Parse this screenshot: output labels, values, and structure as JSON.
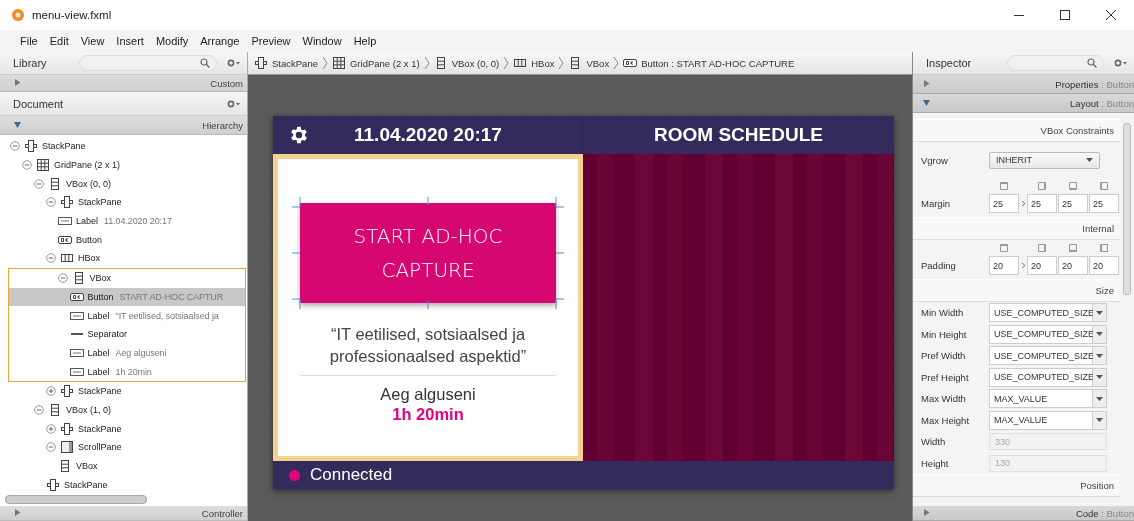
{
  "window": {
    "title": "menu-view.fxml"
  },
  "menu": [
    "File",
    "Edit",
    "View",
    "Insert",
    "Modify",
    "Arrange",
    "Preview",
    "Window",
    "Help"
  ],
  "library": {
    "title": "Library",
    "sections": [
      {
        "title": "Custom",
        "expanded": false
      }
    ]
  },
  "document": {
    "title": "Document",
    "sections": [
      {
        "title": "Hierarchy",
        "expanded": true
      }
    ],
    "tree": [
      {
        "kind": "stackpane",
        "type": "StackPane",
        "expanded": true,
        "selected": false,
        "highlighted": false,
        "children": [
          {
            "kind": "gridpane",
            "type": "GridPane (2 x 1)",
            "expanded": true,
            "selected": false,
            "highlighted": false,
            "children": [
              {
                "kind": "vbox",
                "type": "VBox (0, 0)",
                "expanded": true,
                "selected": false,
                "highlighted": false,
                "children": [
                  {
                    "kind": "stackpane",
                    "type": "StackPane",
                    "expanded": true,
                    "selected": false,
                    "highlighted": false,
                    "children": [
                      {
                        "kind": "label",
                        "type": "Label",
                        "detail": "11.04.2020 20:17",
                        "selected": false,
                        "highlighted": false
                      },
                      {
                        "kind": "button",
                        "type": "Button",
                        "selected": false,
                        "highlighted": false
                      }
                    ]
                  },
                  {
                    "kind": "hbox",
                    "type": "HBox",
                    "expanded": true,
                    "selected": false,
                    "highlighted": false,
                    "children": [
                      {
                        "kind": "vbox",
                        "type": "VBox",
                        "expanded": true,
                        "selected": false,
                        "highlighted": true,
                        "children": [
                          {
                            "kind": "button",
                            "type": "Button",
                            "detail": "START AD-HOC CAPTUR",
                            "selected": true,
                            "highlighted": false
                          },
                          {
                            "kind": "label",
                            "type": "Label",
                            "detail": "\"IT eetilised, sotsiaalsed ja",
                            "selected": false,
                            "highlighted": false
                          },
                          {
                            "kind": "separator",
                            "type": "Separator",
                            "selected": false,
                            "highlighted": false
                          },
                          {
                            "kind": "label",
                            "type": "Label",
                            "detail": "Aeg alguseni",
                            "selected": false,
                            "highlighted": false
                          },
                          {
                            "kind": "label",
                            "type": "Label",
                            "detail": "1h 20min",
                            "selected": false,
                            "highlighted": false
                          }
                        ]
                      }
                    ]
                  },
                  {
                    "kind": "stackpane",
                    "type": "StackPane",
                    "expanded": false,
                    "selected": false,
                    "highlighted": false
                  }
                ]
              },
              {
                "kind": "vbox",
                "type": "VBox (1, 0)",
                "expanded": true,
                "selected": false,
                "highlighted": false,
                "children": [
                  {
                    "kind": "stackpane",
                    "type": "StackPane",
                    "expanded": false,
                    "selected": false,
                    "highlighted": false
                  },
                  {
                    "kind": "scrollpane",
                    "type": "ScrollPane",
                    "expanded": true,
                    "selected": false,
                    "highlighted": false,
                    "children": [
                      {
                        "kind": "vbox",
                        "type": "VBox",
                        "selected": false,
                        "highlighted": false
                      }
                    ]
                  },
                  {
                    "kind": "stackpane",
                    "type": "StackPane",
                    "selected": false,
                    "highlighted": false
                  }
                ]
              }
            ]
          }
        ]
      }
    ],
    "footer_sections": [
      {
        "title": "Controller",
        "expanded": false
      }
    ]
  },
  "breadcrumb": [
    {
      "kind": "stackpane",
      "text": "StackPane"
    },
    {
      "kind": "gridpane",
      "text": "GridPane (2 x 1)"
    },
    {
      "kind": "vbox",
      "text": "VBox (0, 0)"
    },
    {
      "kind": "hbox",
      "text": "HBox"
    },
    {
      "kind": "vbox",
      "text": "VBox"
    },
    {
      "kind": "button",
      "text": "Button : START AD-HOC CAPTURE"
    }
  ],
  "preview": {
    "date": "11.04.2020 20:17",
    "schedule_title": "ROOM SCHEDULE",
    "button": "START AD-HOC CAPTURE",
    "quote": "“IT eetilised, sotsiaalsed ja professionaalsed aspektid”",
    "countdown_label": "Aeg alguseni",
    "countdown": "1h 20min",
    "status": {
      "text": "Connected",
      "color": "#e4007f"
    }
  },
  "inspector": {
    "title": "Inspector",
    "sections": [
      {
        "title": "Properties",
        "subject": ": Button",
        "expanded": false
      },
      {
        "title": "Layout",
        "subject": ": Button",
        "expanded": true
      }
    ],
    "items": [
      {
        "kind": "heading",
        "title": "VBox Constraints"
      },
      {
        "kind": "combo",
        "label": "Vgrow",
        "value": "INHERIT"
      },
      {
        "kind": "quad",
        "label": "Margin",
        "values": [
          "25",
          "25",
          "25",
          "25"
        ]
      },
      {
        "kind": "heading",
        "title": "Internal"
      },
      {
        "kind": "quad",
        "label": "Padding",
        "values": [
          "20",
          "20",
          "20",
          "20"
        ]
      },
      {
        "kind": "heading",
        "title": "Size"
      },
      {
        "kind": "editcombo",
        "label": "Min Width",
        "value": "USE_COMPUTED_SIZE"
      },
      {
        "kind": "editcombo",
        "label": "Min Height",
        "value": "USE_COMPUTED_SIZE"
      },
      {
        "kind": "editcombo",
        "label": "Pref Width",
        "value": "USE_COMPUTED_SIZE"
      },
      {
        "kind": "editcombo",
        "label": "Pref Height",
        "value": "USE_COMPUTED_SIZE"
      },
      {
        "kind": "editcombo",
        "label": "Max Width",
        "value": "MAX_VALUE"
      },
      {
        "kind": "editcombo",
        "label": "Max Height",
        "value": "MAX_VALUE"
      },
      {
        "kind": "field",
        "label": "Width",
        "value": "330",
        "disabled": true
      },
      {
        "kind": "field",
        "label": "Height",
        "value": "130",
        "disabled": true
      },
      {
        "kind": "heading",
        "title": "Position"
      }
    ],
    "footer_sections": [
      {
        "title": "Code",
        "subject": ": Button",
        "expanded": false
      }
    ]
  }
}
